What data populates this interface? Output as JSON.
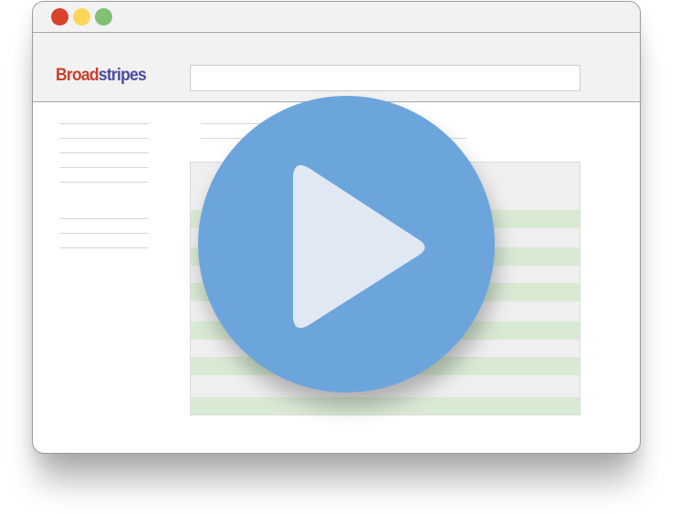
{
  "logo": {
    "part1": "Broad",
    "part2": "stripes"
  },
  "search": {
    "placeholder": ""
  },
  "colors": {
    "close_dot": "#d8432b",
    "minimize_dot": "#fbd65a",
    "maximize_dot": "#82c073",
    "logo_red": "#c8402c",
    "logo_blue": "#4a4aa0",
    "play_circle": "#6ca5db",
    "play_triangle": "#e0e8f3",
    "row_stripe": "#d9ead4"
  },
  "icons": {
    "play": "play-icon"
  }
}
